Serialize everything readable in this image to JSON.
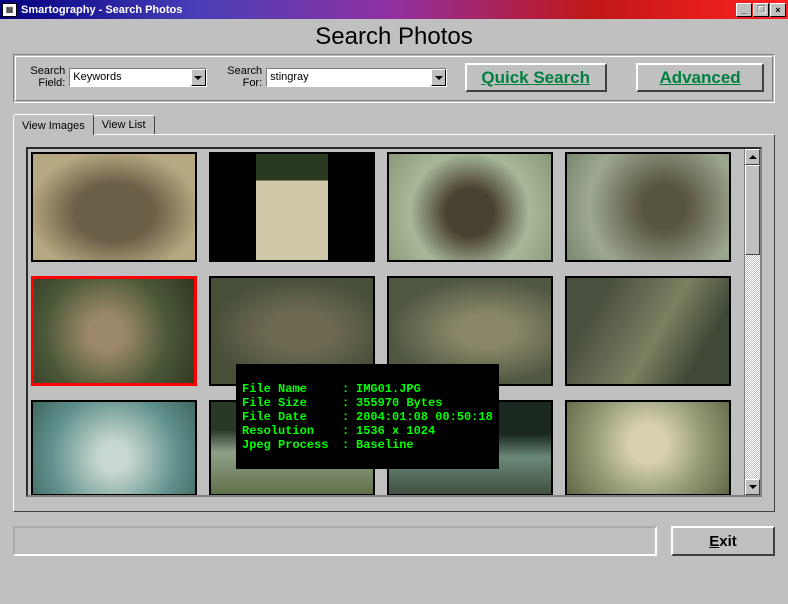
{
  "window": {
    "title": "Smartography - Search Photos",
    "minimize": "_",
    "restore": "❐",
    "close": "×"
  },
  "header": {
    "title": "Search Photos"
  },
  "search": {
    "field_label_1": "Search",
    "field_label_2": "Field:",
    "field_value": "Keywords",
    "for_label_1": "Search",
    "for_label_2": "For:",
    "for_value": "stingray",
    "quick_label": "Quick Search",
    "advanced_label": "Advanced"
  },
  "tabs": {
    "view_images": "View Images",
    "view_list": "View List"
  },
  "tooltip": {
    "rows": [
      {
        "k": "File Name",
        "v": "IMG01.JPG"
      },
      {
        "k": "File Size",
        "v": "355970 Bytes"
      },
      {
        "k": "File Date",
        "v": "2004:01:08 00:50:18"
      },
      {
        "k": "Resolution",
        "v": "1536 x 1024"
      },
      {
        "k": "Jpeg Process",
        "v": "Baseline"
      }
    ]
  },
  "footer": {
    "exit_u": "E",
    "exit_rest": "xit"
  }
}
